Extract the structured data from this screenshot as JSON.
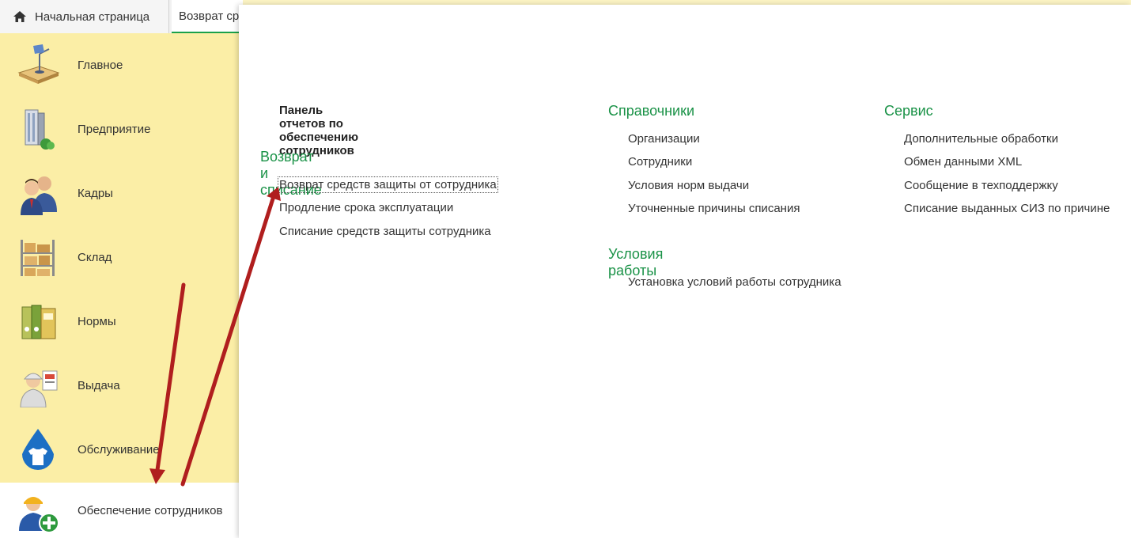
{
  "tabs": {
    "home_label": "Начальная страница",
    "active_label": "Возврат ср"
  },
  "sidebar": {
    "items": [
      {
        "label": "Главное",
        "icon": "desk-lamp-icon"
      },
      {
        "label": "Предприятие",
        "icon": "building-icon"
      },
      {
        "label": "Кадры",
        "icon": "people-icon"
      },
      {
        "label": "Склад",
        "icon": "warehouse-shelf-icon"
      },
      {
        "label": "Нормы",
        "icon": "binders-icon"
      },
      {
        "label": "Выдача",
        "icon": "worker-icon"
      },
      {
        "label": "Обслуживание",
        "icon": "water-drop-shirt-icon"
      },
      {
        "label": "Обеспечение сотрудников",
        "icon": "worker-add-icon"
      }
    ],
    "active_index": 7
  },
  "panel": {
    "reports_title": "Панель отчетов по обеспечению сотрудников",
    "sections": {
      "return": {
        "title": "Возврат и списание",
        "links": [
          "Возврат средств защиты от сотрудника",
          "Продление срока эксплуатации",
          "Списание средств защиты сотрудника"
        ]
      },
      "directories": {
        "title": "Справочники",
        "links": [
          "Организации",
          "Сотрудники",
          "Условия норм выдачи",
          "Уточненные причины списания"
        ]
      },
      "work_conditions": {
        "title": "Условия работы",
        "links": [
          "Установка условий работы сотрудника"
        ]
      },
      "service": {
        "title": "Сервис",
        "links": [
          "Дополнительные обработки",
          "Обмен данными XML",
          "Сообщение в техподдержку",
          "Списание выданных СИЗ по причине"
        ]
      }
    }
  },
  "colors": {
    "sidebar_bg": "#fbeea6",
    "section_title": "#1a9247",
    "arrow": "#b01e1e"
  }
}
